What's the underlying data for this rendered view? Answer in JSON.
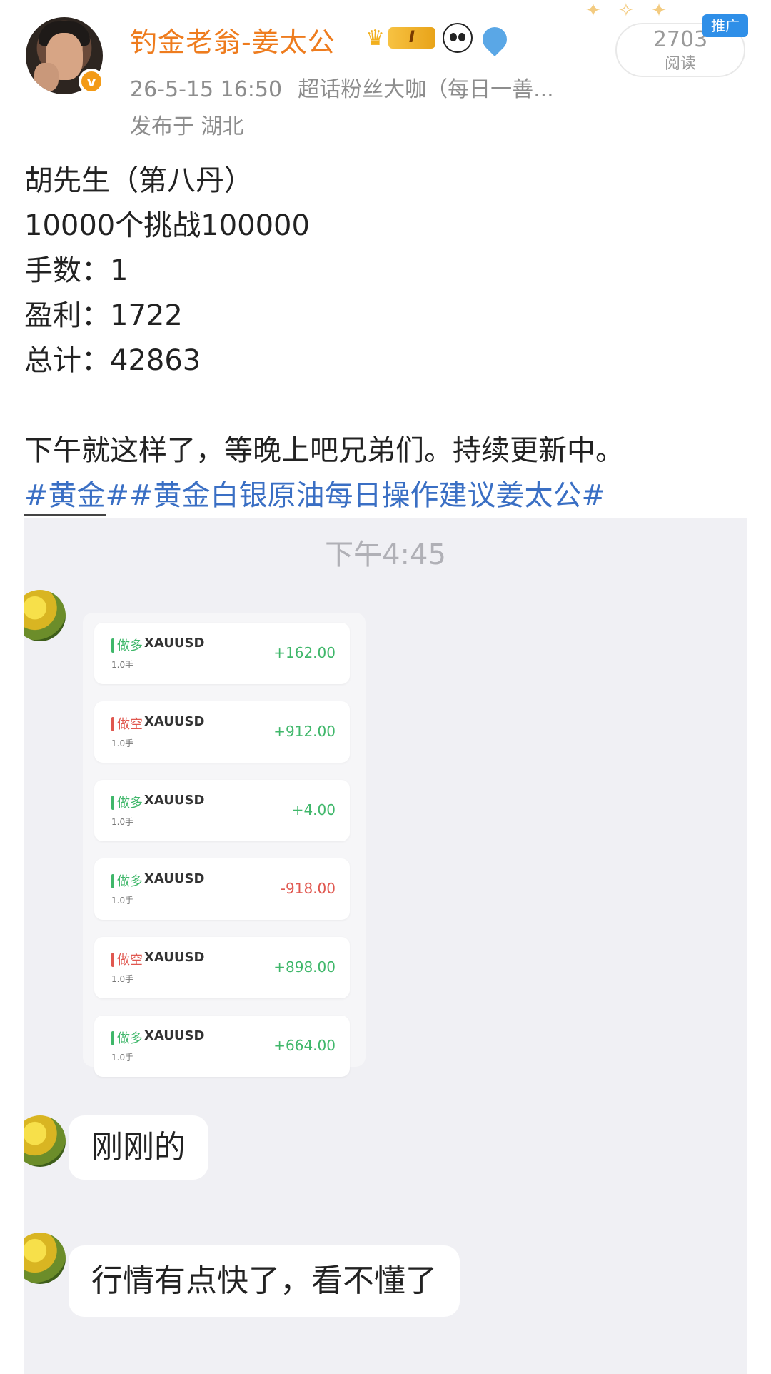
{
  "header": {
    "username": "钓金老翁-姜太公",
    "level_badge": "I",
    "timestamp": "26-5-15 16:50",
    "source": "超话粉丝大咖（每日一善...",
    "location": "发布于 湖北",
    "read_count": "2703",
    "read_label": "阅读",
    "promo_label": "推广",
    "icons": {
      "avatar": "user-avatar",
      "verified": "verified-v-icon",
      "crown": "crown-icon",
      "panda": "panda-icon",
      "drop": "blue-bird-icon",
      "decor": "sparkle-decoration"
    },
    "colors": {
      "username": "#ee7c1e",
      "hashtag": "#3a6fc4",
      "verified": "#f39a16",
      "promo": "#2f8fe8"
    }
  },
  "post": {
    "lines": [
      "胡先生（第八丹）",
      "10000个挑战100000",
      "手数：1",
      "盈利：1722",
      "总计：42863"
    ],
    "paragraph": "下午就这样了，等晚上吧兄弟们。持续更新中。",
    "hashtags": "#黄金##黄金白银原油每日操作建议姜太公#"
  },
  "screenshot": {
    "time": "下午4:45",
    "trades": [
      {
        "direction": "做多",
        "side": "long",
        "symbol": "XAUUSD",
        "lots": "1.0手",
        "pnl": "+162.00"
      },
      {
        "direction": "做空",
        "side": "short",
        "symbol": "XAUUSD",
        "lots": "1.0手",
        "pnl": "+912.00"
      },
      {
        "direction": "做多",
        "side": "long",
        "symbol": "XAUUSD",
        "lots": "1.0手",
        "pnl": "+4.00"
      },
      {
        "direction": "做多",
        "side": "long",
        "symbol": "XAUUSD",
        "lots": "1.0手",
        "pnl": "-918.00"
      },
      {
        "direction": "做空",
        "side": "short",
        "symbol": "XAUUSD",
        "lots": "1.0手",
        "pnl": "+898.00"
      },
      {
        "direction": "做多",
        "side": "long",
        "symbol": "XAUUSD",
        "lots": "1.0手",
        "pnl": "+664.00"
      }
    ],
    "messages": [
      "刚刚的",
      "行情有点快了，看不懂了"
    ]
  }
}
